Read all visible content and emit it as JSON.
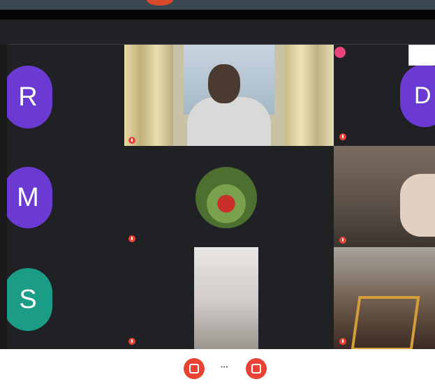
{
  "top": {
    "label": ""
  },
  "participants": [
    {
      "id": "r",
      "initial": "R",
      "color": "#6a3ad3"
    },
    {
      "id": "main",
      "name": ""
    },
    {
      "id": "d",
      "initial": "D",
      "color": "#6a3ad3",
      "name": ""
    },
    {
      "id": "m",
      "initial": "M",
      "color": "#6a3ad3"
    },
    {
      "id": "photo",
      "name": ""
    },
    {
      "id": "cam2",
      "name": ""
    },
    {
      "id": "s",
      "initial": "S",
      "color": "#1a9c86"
    },
    {
      "id": "cam3",
      "name": ""
    },
    {
      "id": "cam4",
      "name": ""
    }
  ],
  "topright": {
    "label_line1": "",
    "label_line2": "",
    "box": ""
  },
  "controls": {
    "more": "•••",
    "corner_line1": "",
    "corner_line2": ""
  },
  "colors": {
    "mic_off": "#ea4335",
    "avatar_purple": "#6a3ad3",
    "avatar_teal": "#1a9c86",
    "surface": "#202124"
  }
}
